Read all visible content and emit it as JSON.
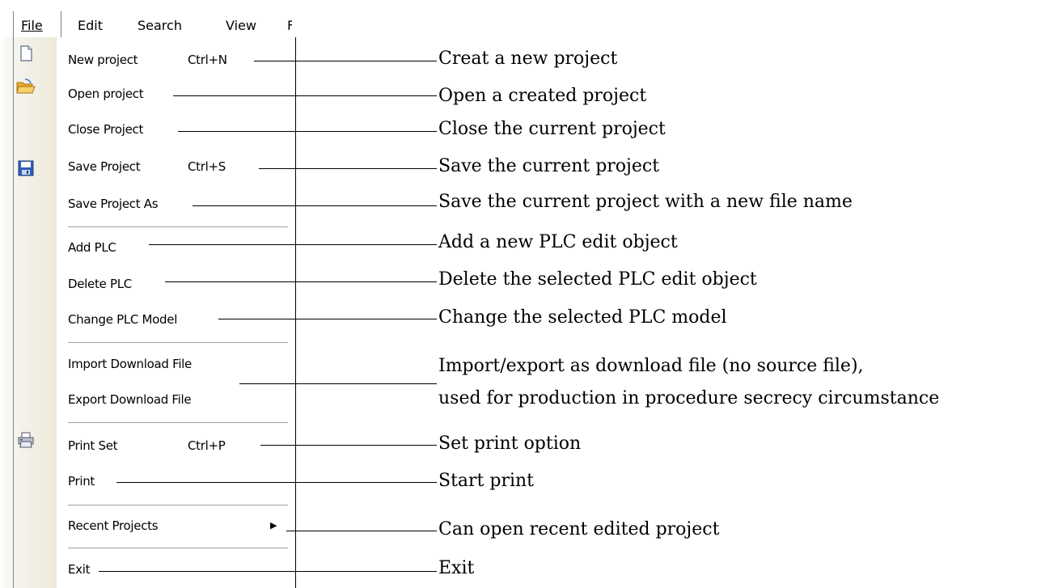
{
  "menubar": {
    "file": "File",
    "edit": "Edit",
    "search": "Search",
    "view": "View"
  },
  "file_menu": {
    "new_project": "New project",
    "new_project_shortcut": "Ctrl+N",
    "open_project": "Open project",
    "close_project": "Close Project",
    "save_project": "Save Project",
    "save_project_shortcut": "Ctrl+S",
    "save_project_as": "Save Project As",
    "add_plc": "Add PLC",
    "delete_plc": "Delete PLC",
    "change_plc_model": "Change PLC Model",
    "import_download_file": "Import Download File",
    "export_download_file": "Export Download File",
    "print_set": "Print Set",
    "print_set_shortcut": "Ctrl+P",
    "print": "Print",
    "recent_projects": "Recent Projects",
    "exit": "Exit"
  },
  "annotations": {
    "new_project": "Creat a new project",
    "open_project": "Open a created project",
    "close_project": "Close the current project",
    "save_project": "Save the current project",
    "save_project_as": "Save the current project with a new file name",
    "add_plc": "Add a new PLC edit object",
    "delete_plc": "Delete the selected PLC edit object",
    "change_plc_model": "Change the selected PLC model",
    "download_file_line1": "Import/export as download file (no source file),",
    "download_file_line2": "used for production in procedure secrecy circumstance",
    "print_set": "Set print option",
    "print": "Start print",
    "recent_projects": "Can open recent edited project",
    "exit": "Exit"
  },
  "icons": {
    "new_project": "new-document-icon",
    "open_project": "open-folder-icon",
    "save_project": "floppy-disk-icon",
    "print_set": "printer-icon",
    "recent_projects": "submenu-arrow-icon"
  },
  "colors": {
    "menu_background": "#ffffff",
    "icon_strip": "#ece9d8",
    "folder": "#f2c14e",
    "floppy": "#2d5fb5"
  }
}
